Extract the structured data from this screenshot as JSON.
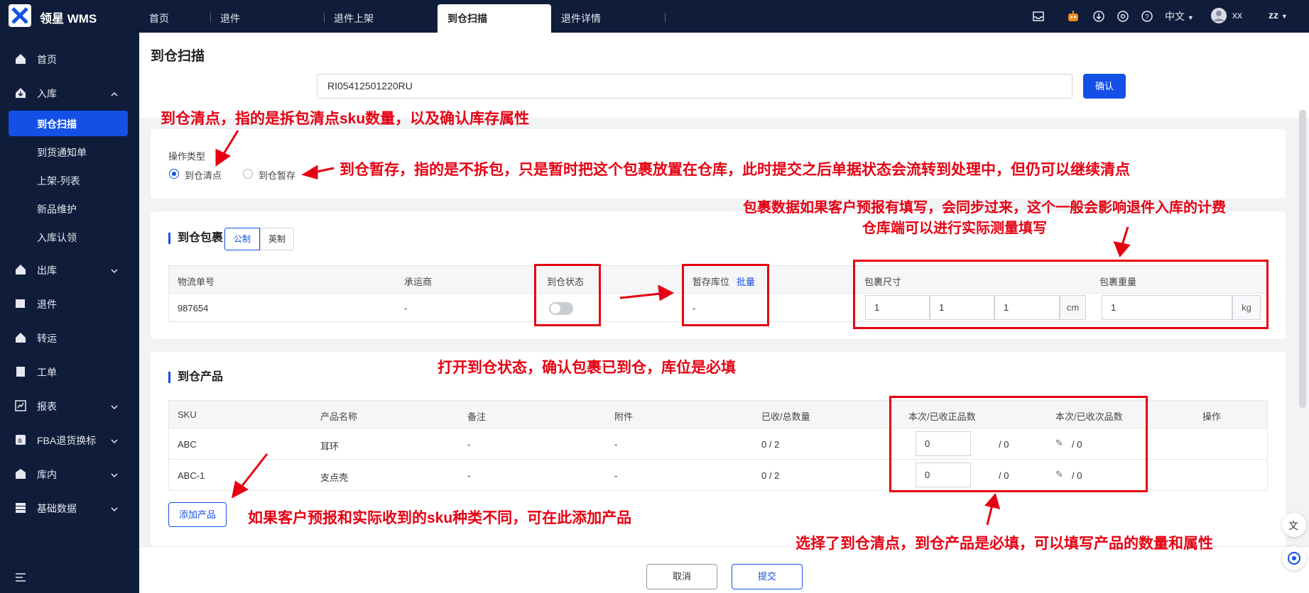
{
  "app": {
    "title": "领星 WMS",
    "user": "xx",
    "lang": "中文",
    "account": "zz"
  },
  "tabs": [
    "首页",
    "退件",
    "退件上架",
    "到仓扫描",
    "退件详情"
  ],
  "sidebar": {
    "items": [
      {
        "label": "首页",
        "icon": "home-icon"
      },
      {
        "label": "入库",
        "icon": "inbound-icon"
      },
      {
        "label": "出库",
        "icon": "outbound-icon"
      },
      {
        "label": "退件",
        "icon": "return-icon"
      },
      {
        "label": "转运",
        "icon": "transfer-icon"
      },
      {
        "label": "工单",
        "icon": "workorder-icon"
      },
      {
        "label": "报表",
        "icon": "report-icon"
      },
      {
        "label": "FBA退货换标",
        "icon": "fba-icon"
      },
      {
        "label": "库内",
        "icon": "warehouse-icon"
      },
      {
        "label": "基础数据",
        "icon": "data-icon"
      }
    ],
    "subitems": [
      "到仓扫描",
      "到货通知单",
      "上架-列表",
      "新品维护",
      "入库认领"
    ]
  },
  "page": {
    "title": "到仓扫描",
    "scan_value": "RI05412501220RU",
    "confirm_label": "确认"
  },
  "operation": {
    "label": "操作类型",
    "option_count": "到仓清点",
    "option_temp": "到仓暂存"
  },
  "package": {
    "title": "到仓包裹",
    "unit_metric": "公制",
    "unit_imperial": "英制",
    "headers": {
      "tracking": "物流单号",
      "carrier": "承运商",
      "status": "到仓状态",
      "location": "暂存库位",
      "batch": "批量",
      "size": "包裹尺寸",
      "weight": "包裹重量"
    },
    "row": {
      "tracking": "987654",
      "carrier": "-",
      "location": "-",
      "l": "1",
      "w": "1",
      "h": "1",
      "size_unit": "cm",
      "weight": "1",
      "weight_unit": "kg"
    }
  },
  "products": {
    "title": "到仓产品",
    "headers": [
      "SKU",
      "产品名称",
      "备注",
      "附件",
      "已收/总数量",
      "本次/已收正品数",
      "本次/已收次品数",
      "操作"
    ],
    "rows": [
      {
        "sku": "ABC",
        "name": "耳环",
        "note": "-",
        "attach": "-",
        "recv": "0 / 2",
        "good": "0",
        "good_total": "/ 0",
        "bad_total": "/ 0"
      },
      {
        "sku": "ABC-1",
        "name": "支点壳",
        "note": "-",
        "attach": "-",
        "recv": "0 / 2",
        "good": "0",
        "good_total": "/ 0",
        "bad_total": "/ 0"
      }
    ],
    "add_label": "添加产品"
  },
  "footer": {
    "cancel": "取消",
    "submit": "提交"
  },
  "annotations": {
    "a1": "到仓清点，指的是拆包清点sku数量，以及确认库存属性",
    "a2": "到仓暂存，指的是不拆包，只是暂时把这个包裹放置在仓库，此时提交之后单据状态会流转到处理中，但仍可以继续清点",
    "a3": "包裹数据如果客户预报有填写，会同步过来，这个一般会影响退件入库的计费",
    "a4": "仓库端可以进行实际测量填写",
    "a5": "打开到仓状态，确认包裹已到仓，库位是必填",
    "a6": "如果客户预报和实际收到的sku种类不同，可在此添加产品",
    "a7": "选择了到仓清点，到仓产品是必填，可以填写产品的数量和属性"
  },
  "colors": {
    "accent": "#1550e6",
    "nav_bg": "#0f1d3a",
    "annotation": "#e60012"
  }
}
